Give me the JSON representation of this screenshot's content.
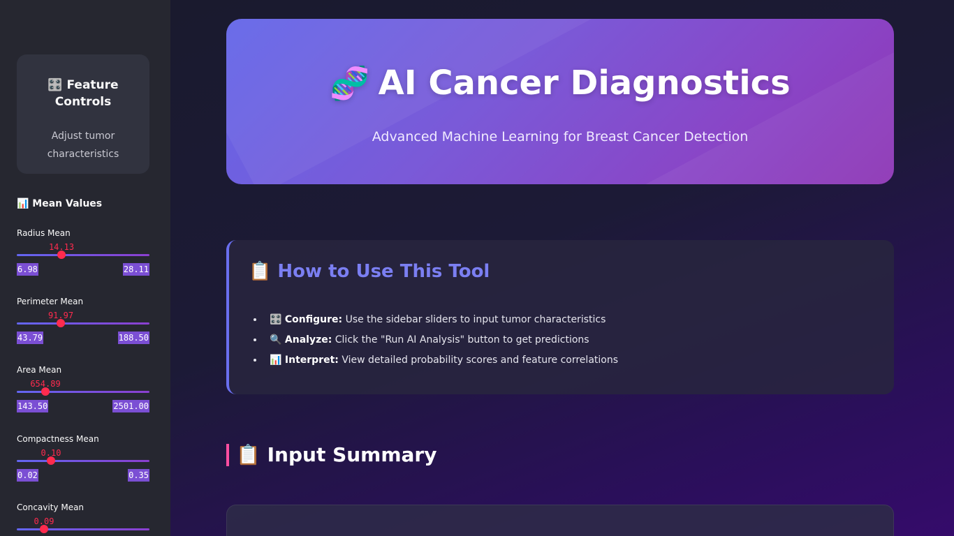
{
  "sidebar": {
    "card_title": "🎛️ Feature Controls",
    "card_subtitle": "Adjust tumor characteristics",
    "section_title": "📊 Mean Values",
    "sliders": [
      {
        "label": "Radius Mean",
        "value": "14.13",
        "min": "6.98",
        "max": "28.11",
        "fraction": 0.34
      },
      {
        "label": "Perimeter Mean",
        "value": "91.97",
        "min": "43.79",
        "max": "188.50",
        "fraction": 0.33
      },
      {
        "label": "Area Mean",
        "value": "654.89",
        "min": "143.50",
        "max": "2501.00",
        "fraction": 0.22
      },
      {
        "label": "Compactness Mean",
        "value": "0.10",
        "min": "0.02",
        "max": "0.35",
        "fraction": 0.26
      },
      {
        "label": "Concavity Mean",
        "value": "0.09",
        "min": "",
        "max": "",
        "fraction": 0.2
      }
    ]
  },
  "hero": {
    "icon": "dna-icon",
    "title": "AI Cancer Diagnostics",
    "subtitle": "Advanced Machine Learning for Breast Cancer Detection"
  },
  "howto": {
    "title": "📋 How to Use This Tool",
    "items": [
      {
        "icon": "🎛️",
        "label": "Configure:",
        "text": " Use the sidebar sliders to input tumor characteristics"
      },
      {
        "icon": "🔍",
        "label": "Analyze:",
        "text": " Click the \"Run AI Analysis\" button to get predictions"
      },
      {
        "icon": "📊",
        "label": "Interpret:",
        "text": " View detailed probability scores and feature correlations"
      }
    ]
  },
  "summary": {
    "title": "📋 Input Summary"
  },
  "colors": {
    "accent": "#6366f1",
    "slider_thumb": "#ff2b4e",
    "pink_accent": "#ff4ea0"
  }
}
